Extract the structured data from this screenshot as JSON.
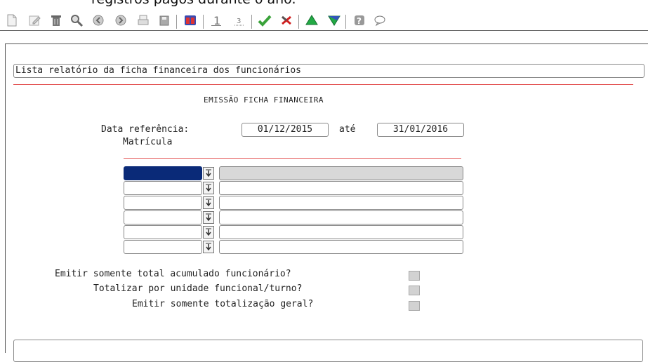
{
  "doc_text": "registros pagos durante o ano.",
  "toolbar": {
    "icons": [
      "new-document-icon",
      "edit-icon",
      "delete-trash-icon",
      "search-icon",
      "back-icon",
      "forward-icon",
      "print-icon",
      "save-icon",
      "binoculars-icon",
      "first-page-icon",
      "list-icon",
      "confirm-check-icon",
      "cancel-x-icon",
      "up-arrow-icon",
      "down-arrow-icon",
      "help-icon",
      "comment-icon"
    ]
  },
  "description": "Lista relatório da ficha financeira dos funcionários",
  "form": {
    "title": "EMISSÃO FICHA FINANCEIRA",
    "data_referencia_label": "Data referência:",
    "date_from": "01/12/2015",
    "ate_label": "até",
    "date_to": "31/01/2016",
    "matricula_label": "Matrícula"
  },
  "questions": [
    {
      "label": "Emitir somente total acumulado funcionário?",
      "checked": false
    },
    {
      "label": "Totalizar por unidade funcional/turno?",
      "checked": false
    },
    {
      "label": "Emitir somente totalização geral?",
      "checked": false
    }
  ],
  "colors": {
    "accent_red": "#e35050",
    "focus_blue": "#0a2a78",
    "confirm_green": "#3aa23a",
    "cancel_red": "#d02020"
  }
}
